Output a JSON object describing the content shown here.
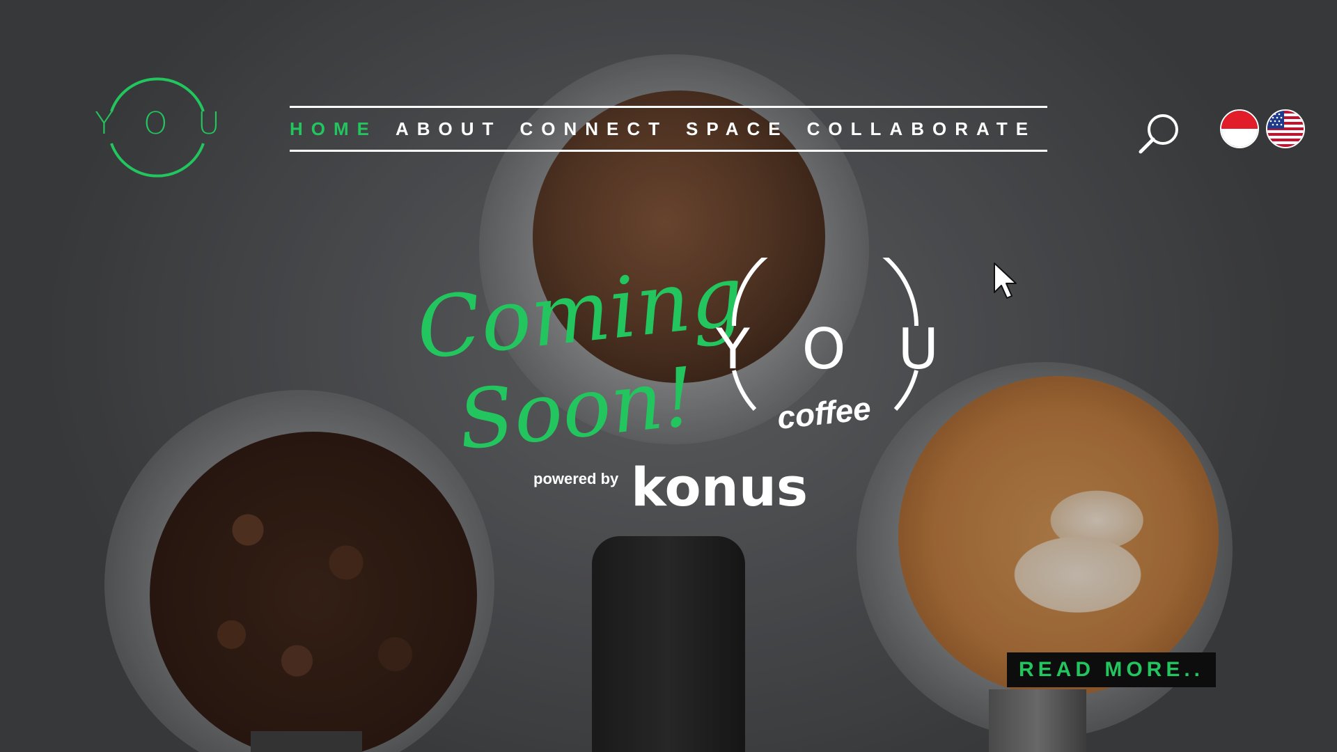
{
  "brand": {
    "logo_letters": [
      "Y",
      "O",
      "U"
    ],
    "accent_color": "#22c55e"
  },
  "nav": {
    "items": [
      {
        "label": "HOME",
        "active": true
      },
      {
        "label": "ABOUT",
        "active": false
      },
      {
        "label": "CONNECT",
        "active": false
      },
      {
        "label": "SPACE",
        "active": false
      },
      {
        "label": "COLLABORATE",
        "active": false
      }
    ]
  },
  "header_icons": {
    "search": "search-icon",
    "languages": [
      "indonesia-flag-icon",
      "us-flag-icon"
    ]
  },
  "hero": {
    "coming_line1": "Coming",
    "coming_line2": "Soon!",
    "you_letters": [
      "Y",
      "O",
      "U"
    ],
    "coffee_label": "coffee",
    "powered_by": "powered by",
    "partner": "konus"
  },
  "cta": {
    "read_more": "READ MORE.."
  }
}
